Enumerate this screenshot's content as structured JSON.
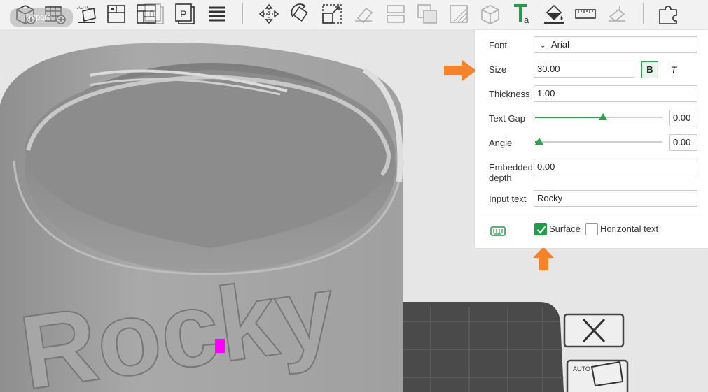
{
  "toolbar": {
    "back_label": "Prepare",
    "buttons": [
      {
        "name": "add-object-icon",
        "dim": false
      },
      {
        "name": "add-plate-icon",
        "dim": false
      },
      {
        "name": "auto-orient-icon",
        "dim": false
      },
      {
        "name": "arrange-icon",
        "dim": false
      },
      {
        "name": "layout-icon",
        "dim": false
      },
      {
        "name": "plate-0-icon",
        "dim": true
      },
      {
        "name": "plate-p-icon",
        "dim": false
      },
      {
        "name": "layers-icon",
        "dim": false
      },
      {
        "name": "move-icon",
        "dim": false
      },
      {
        "name": "rotate-icon",
        "dim": false
      },
      {
        "name": "scale-icon",
        "dim": false
      },
      {
        "name": "lay-on-face-icon",
        "dim": true
      },
      {
        "name": "cut-icon",
        "dim": true
      },
      {
        "name": "mesh-boolean-icon",
        "dim": true
      },
      {
        "name": "support-paint-icon",
        "dim": true
      },
      {
        "name": "seam-paint-icon",
        "dim": true
      },
      {
        "name": "text-tool-icon",
        "dim": false
      },
      {
        "name": "color-paint-icon",
        "dim": false
      },
      {
        "name": "measure-icon",
        "dim": false
      },
      {
        "name": "assembly-icon",
        "dim": true
      },
      {
        "name": "split-parts-icon",
        "dim": false
      }
    ]
  },
  "text_panel": {
    "font_label": "Font",
    "font_value": "Arial",
    "size_label": "Size",
    "size_value": "30.00",
    "bold_label": "B",
    "italic_label": "T",
    "thickness_label": "Thickness",
    "thickness_value": "1.00",
    "text_gap_label": "Text Gap",
    "text_gap_value": "0.00",
    "text_gap_slider": 0.5,
    "angle_label": "Angle",
    "angle_value": "0.00",
    "angle_slider": 0.0,
    "embedded_depth_label_1": "Embedded",
    "embedded_depth_label_2": "depth",
    "embedded_depth_value": "0.00",
    "input_text_label": "Input text",
    "input_text_value": "Rocky",
    "surface_label": "Surface",
    "surface_checked": true,
    "horizontal_text_label": "Horizontal text",
    "horizontal_text_checked": false
  },
  "model": {
    "embossed_text": "Rocky"
  },
  "colors": {
    "accent": "#1f9d4a",
    "arrow": "#f5832a",
    "marker": "#ff00ff",
    "model": "#a9a9a9",
    "plate": "#4a4a4a"
  }
}
